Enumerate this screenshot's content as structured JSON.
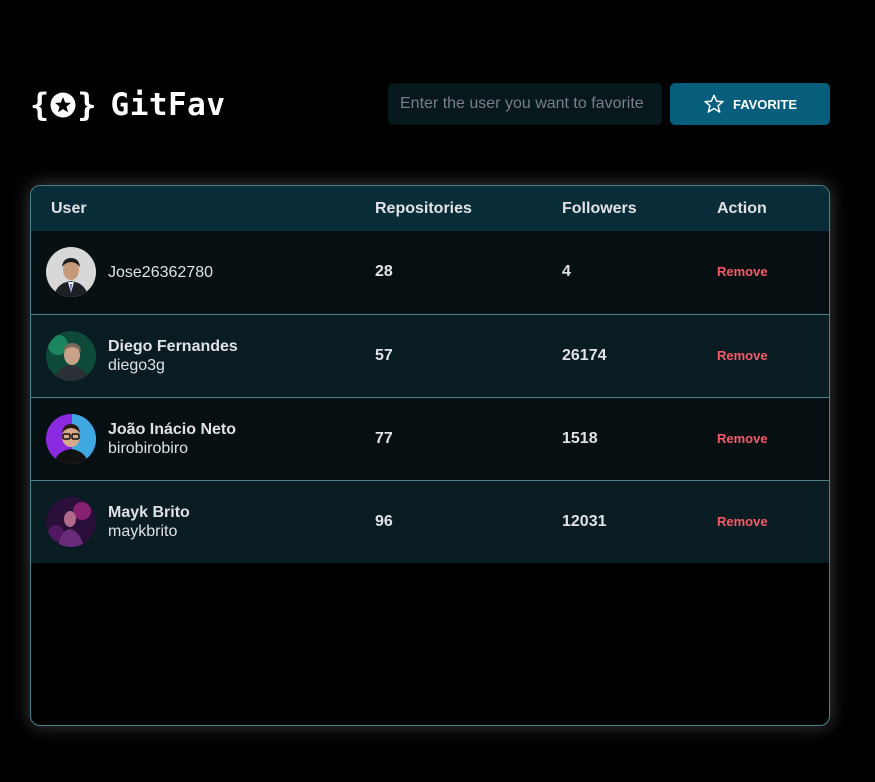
{
  "app": {
    "title": "GitFav",
    "brace_open": "{",
    "brace_close": "}",
    "logo_icon": "star-icon"
  },
  "search": {
    "placeholder": "Enter the user you want to favorite",
    "value": "",
    "button_label": "FAVORITE",
    "button_icon": "star-outline-icon"
  },
  "table": {
    "headers": {
      "user": "User",
      "repositories": "Repositories",
      "followers": "Followers",
      "action": "Action"
    },
    "rows": [
      {
        "name": "",
        "login": "Jose26362780",
        "repositories": "28",
        "followers": "4",
        "action": "Remove"
      },
      {
        "name": "Diego Fernandes",
        "login": "diego3g",
        "repositories": "57",
        "followers": "26174",
        "action": "Remove"
      },
      {
        "name": "João Inácio Neto",
        "login": "birobirobiro",
        "repositories": "77",
        "followers": "1518",
        "action": "Remove"
      },
      {
        "name": "Mayk Brito",
        "login": "maykbrito",
        "repositories": "96",
        "followers": "12031",
        "action": "Remove"
      }
    ]
  },
  "colors": {
    "background": "#000000",
    "accent": "#065e7c",
    "header_row": "#092d38",
    "row_odd": "#060f12",
    "row_even": "#081c22",
    "border": "#4a808c",
    "danger": "#f75a68",
    "text": "#e1e1e6",
    "placeholder": "#7c7c8a"
  }
}
